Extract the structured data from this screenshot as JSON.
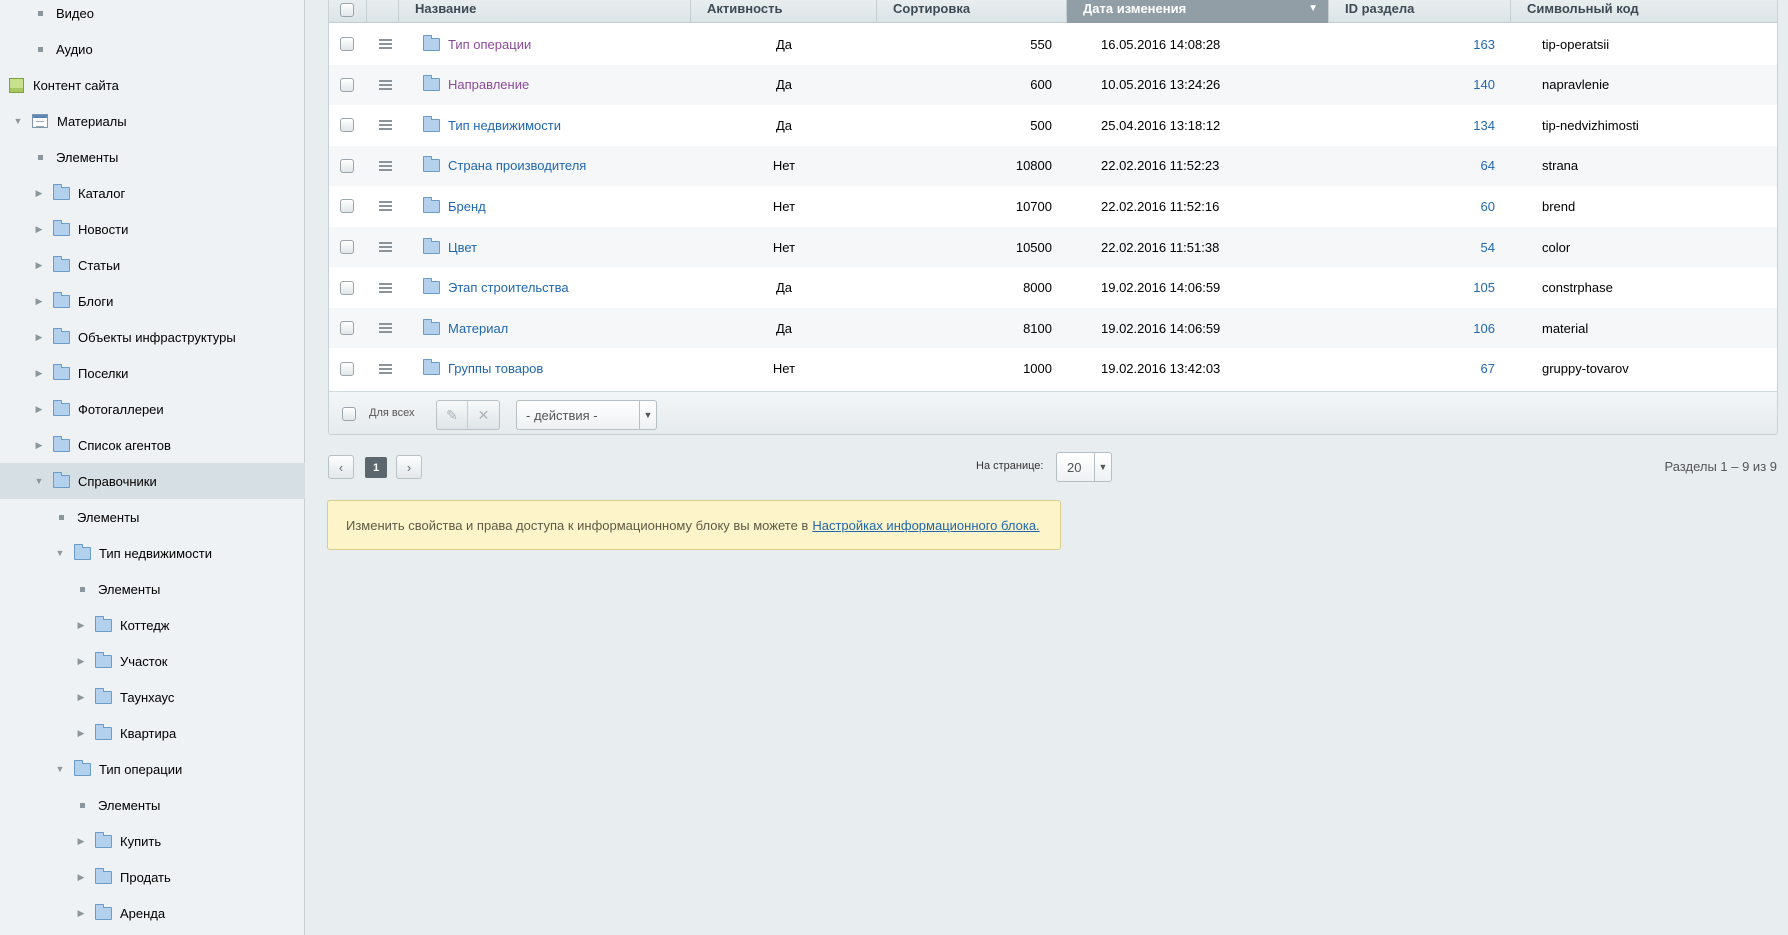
{
  "sidebar": {
    "items": [
      {
        "label": "Видео"
      },
      {
        "label": "Аудио"
      },
      {
        "label": "Контент сайта"
      },
      {
        "label": "Материалы"
      },
      {
        "label": "Элементы"
      },
      {
        "label": "Каталог"
      },
      {
        "label": "Новости"
      },
      {
        "label": "Статьи"
      },
      {
        "label": "Блоги"
      },
      {
        "label": "Объекты инфраструктуры"
      },
      {
        "label": "Поселки"
      },
      {
        "label": "Фотогаллереи"
      },
      {
        "label": "Список агентов"
      },
      {
        "label": "Справочники"
      },
      {
        "label": "Элементы"
      },
      {
        "label": "Тип недвижимости"
      },
      {
        "label": "Элементы"
      },
      {
        "label": "Коттедж"
      },
      {
        "label": "Участок"
      },
      {
        "label": "Таунхаус"
      },
      {
        "label": "Квартира"
      },
      {
        "label": "Тип операции"
      },
      {
        "label": "Элементы"
      },
      {
        "label": "Купить"
      },
      {
        "label": "Продать"
      },
      {
        "label": "Аренда"
      }
    ]
  },
  "grid": {
    "columns": {
      "name": "Название",
      "active": "Активность",
      "sort": "Сортировка",
      "date": "Дата изменения",
      "id": "ID раздела",
      "code": "Символьный код"
    },
    "rows": [
      {
        "name": "Тип операции",
        "active": "Да",
        "sort": "550",
        "date": "16.05.2016 14:08:28",
        "id": "163",
        "code": "tip-operatsii"
      },
      {
        "name": "Направление",
        "active": "Да",
        "sort": "600",
        "date": "10.05.2016 13:24:26",
        "id": "140",
        "code": "napravlenie"
      },
      {
        "name": "Тип недвижимости",
        "active": "Да",
        "sort": "500",
        "date": "25.04.2016 13:18:12",
        "id": "134",
        "code": "tip-nedvizhimosti"
      },
      {
        "name": "Страна производителя",
        "active": "Нет",
        "sort": "10800",
        "date": "22.02.2016 11:52:23",
        "id": "64",
        "code": "strana"
      },
      {
        "name": "Бренд",
        "active": "Нет",
        "sort": "10700",
        "date": "22.02.2016 11:52:16",
        "id": "60",
        "code": "brend"
      },
      {
        "name": "Цвет",
        "active": "Нет",
        "sort": "10500",
        "date": "22.02.2016 11:51:38",
        "id": "54",
        "code": "color"
      },
      {
        "name": "Этап строительства",
        "active": "Да",
        "sort": "8000",
        "date": "19.02.2016 14:06:59",
        "id": "105",
        "code": "constrphase"
      },
      {
        "name": "Материал",
        "active": "Да",
        "sort": "8100",
        "date": "19.02.2016 14:06:59",
        "id": "106",
        "code": "material"
      },
      {
        "name": "Группы товаров",
        "active": "Нет",
        "sort": "1000",
        "date": "19.02.2016 13:42:03",
        "id": "67",
        "code": "gruppy-tovarov"
      }
    ],
    "footer": {
      "for_all": "Для всех",
      "actions": "- действия -"
    }
  },
  "pager": {
    "prev": "‹",
    "current": "1",
    "next": "›",
    "per_page_label": "На странице:",
    "per_page_value": "20",
    "summary": "Разделы 1 – 9 из 9"
  },
  "notice": {
    "text": "Изменить свойства и права доступа к информационному блоку вы можете в",
    "link": "Настройках информационного блока."
  },
  "colors": {
    "link": "#2067b0",
    "visited_link": "#8c4a9a",
    "sorted_header": "#929ea5",
    "notice_bg": "#fdf5c9"
  }
}
